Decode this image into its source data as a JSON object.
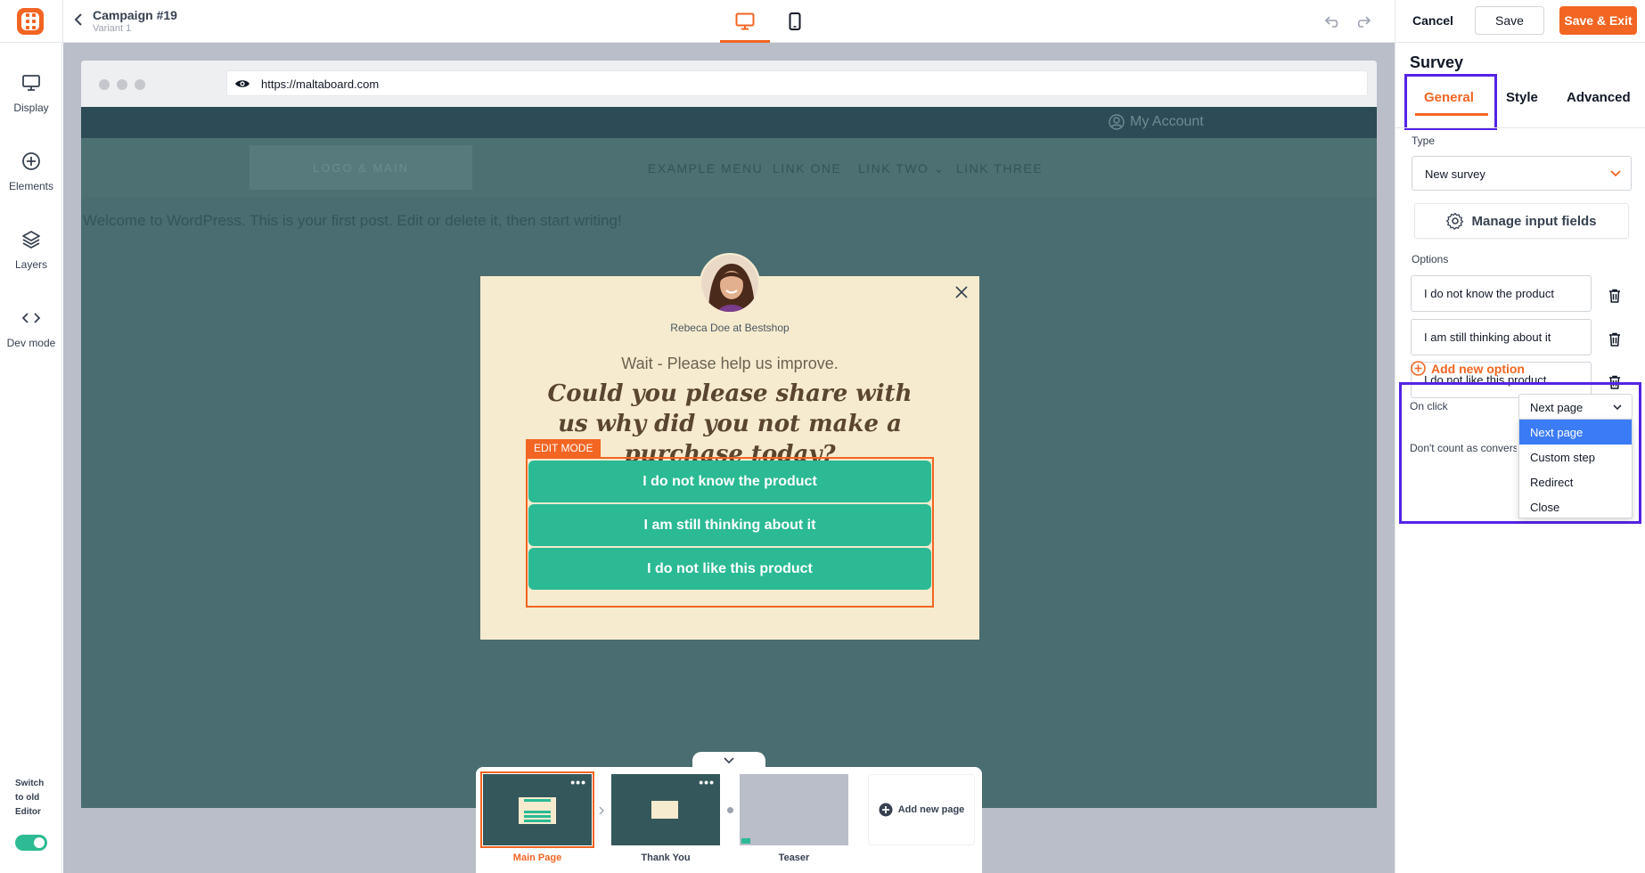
{
  "campaign": {
    "title": "Campaign #19",
    "variant": "Variant 1"
  },
  "toolbar": {
    "cancel_label": "Cancel",
    "save_label": "Save",
    "save_exit_label": "Save & Exit"
  },
  "sidebar": {
    "items": [
      {
        "label": "Display",
        "icon": "monitor-icon"
      },
      {
        "label": "Elements",
        "icon": "plus-circle-icon"
      },
      {
        "label": "Layers",
        "icon": "layers-icon"
      },
      {
        "label": "Dev mode",
        "icon": "code-icon"
      }
    ],
    "switch_label": "Switch to old Editor",
    "switch_on": true
  },
  "browser": {
    "url": "https://maltaboard.com"
  },
  "site": {
    "my_account": "My Account",
    "logo_text": "LOGO & MAIN",
    "nav": [
      "EXAMPLE MENU",
      "LINK ONE",
      "LINK TWO ⌄",
      "LINK THREE"
    ],
    "welcome": "Welcome to WordPress. This is your first post. Edit or delete it, then start writing!"
  },
  "popup": {
    "author": "Rebeca Doe at Bestshop",
    "wait": "Wait - Please help us improve.",
    "question": "Could you please share with us why did you not make a purchase today?",
    "edit_badge": "EDIT MODE",
    "options": [
      "I do not know the product",
      "I am still thinking about it",
      "I do not like this product"
    ]
  },
  "pages": {
    "items": [
      {
        "label": "Main Page",
        "active": true
      },
      {
        "label": "Thank You",
        "active": false
      },
      {
        "label": "Teaser",
        "active": false
      }
    ],
    "add_label": "Add new page"
  },
  "panel": {
    "title": "Survey",
    "tabs": [
      "General",
      "Style",
      "Advanced"
    ],
    "active_tab": "General",
    "type_label": "Type",
    "type_value": "New survey",
    "manage_label": "Manage input fields",
    "options_label": "Options",
    "options": [
      "I do not know the product",
      "I am still thinking about it",
      "I do not like this product"
    ],
    "add_option": "Add new option",
    "onclick_label": "On click",
    "onclick_value": "Next page",
    "onclick_options": [
      "Next page",
      "Custom step",
      "Redirect",
      "Close"
    ],
    "dont_count_label": "Don't count as conversion"
  },
  "colors": {
    "accent": "#f26522",
    "survey_green": "#2bba94",
    "highlight": "#5423e6",
    "site_bg": "#496d70",
    "popup_bg": "#f6ebce"
  }
}
